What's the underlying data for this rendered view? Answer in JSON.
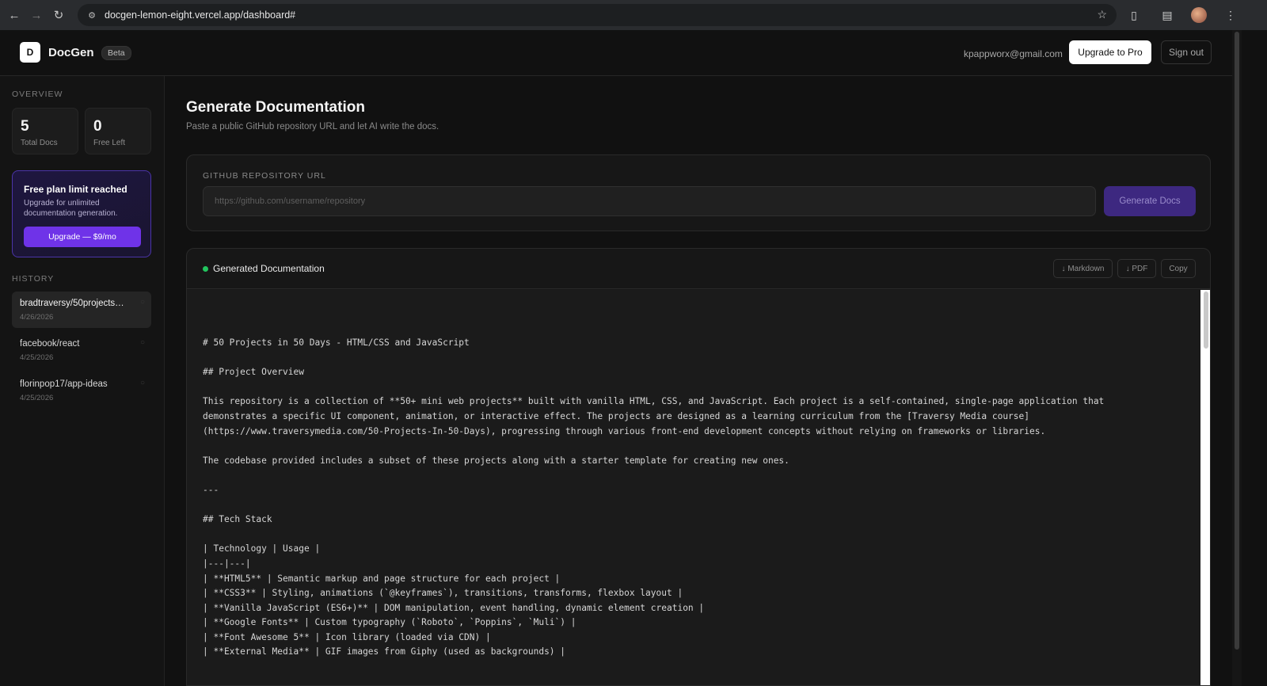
{
  "browser": {
    "url": "docgen-lemon-eight.vercel.app/dashboard#"
  },
  "header": {
    "logo_letter": "D",
    "brand": "DocGen",
    "badge": "Beta",
    "email": "kpappworx@gmail.com",
    "upgrade_pro_label": "Upgrade to Pro",
    "signout_label": "Sign out"
  },
  "sidebar": {
    "overview_label": "OVERVIEW",
    "stats": [
      {
        "value": "5",
        "label": "Total Docs"
      },
      {
        "value": "0",
        "label": "Free Left"
      }
    ],
    "limit": {
      "title": "Free plan limit reached",
      "description": "Upgrade for unlimited documentation generation.",
      "button": "Upgrade — $9/mo"
    },
    "history_label": "HISTORY",
    "history": [
      {
        "name": "bradtraversy/50projects…",
        "date": "4/26/2026"
      },
      {
        "name": "facebook/react",
        "date": "4/25/2026"
      },
      {
        "name": "florinpop17/app-ideas",
        "date": "4/25/2026"
      }
    ]
  },
  "main": {
    "title": "Generate Documentation",
    "subtitle": "Paste a public GitHub repository URL and let AI write the docs.",
    "url_label": "GITHUB REPOSITORY URL",
    "url_placeholder": "https://github.com/username/repository",
    "url_value": "",
    "generate_label": "Generate Docs"
  },
  "doc": {
    "title": "Generated Documentation",
    "markdown_label": "↓ Markdown",
    "pdf_label": "↓ PDF",
    "copy_label": "Copy",
    "lines": [
      "# 50 Projects in 50 Days - HTML/CSS and JavaScript",
      "",
      "## Project Overview",
      "",
      "This repository is a collection of **50+ mini web projects** built with vanilla HTML, CSS, and JavaScript. Each project is a self-contained, single-page application that",
      "demonstrates a specific UI component, animation, or interactive effect. The projects are designed as a learning curriculum from the [Traversy Media course]",
      "(https://www.traversymedia.com/50-Projects-In-50-Days), progressing through various front-end development concepts without relying on frameworks or libraries.",
      "",
      "The codebase provided includes a subset of these projects along with a starter template for creating new ones.",
      "",
      "---",
      "",
      "## Tech Stack",
      "",
      "| Technology | Usage |",
      "|---|---|",
      "| **HTML5** | Semantic markup and page structure for each project |",
      "| **CSS3** | Styling, animations (`@keyframes`), transitions, transforms, flexbox layout |",
      "| **Vanilla JavaScript (ES6+)** | DOM manipulation, event handling, dynamic element creation |",
      "| **Google Fonts** | Custom typography (`Roboto`, `Poppins`, `Muli`) |",
      "| **Font Awesome 5** | Icon library (loaded via CDN) |",
      "| **External Media** | GIF images from Giphy (used as backgrounds) |"
    ]
  },
  "colors": {
    "accent": "#6f33e8",
    "status_dot": "#22c55e"
  }
}
